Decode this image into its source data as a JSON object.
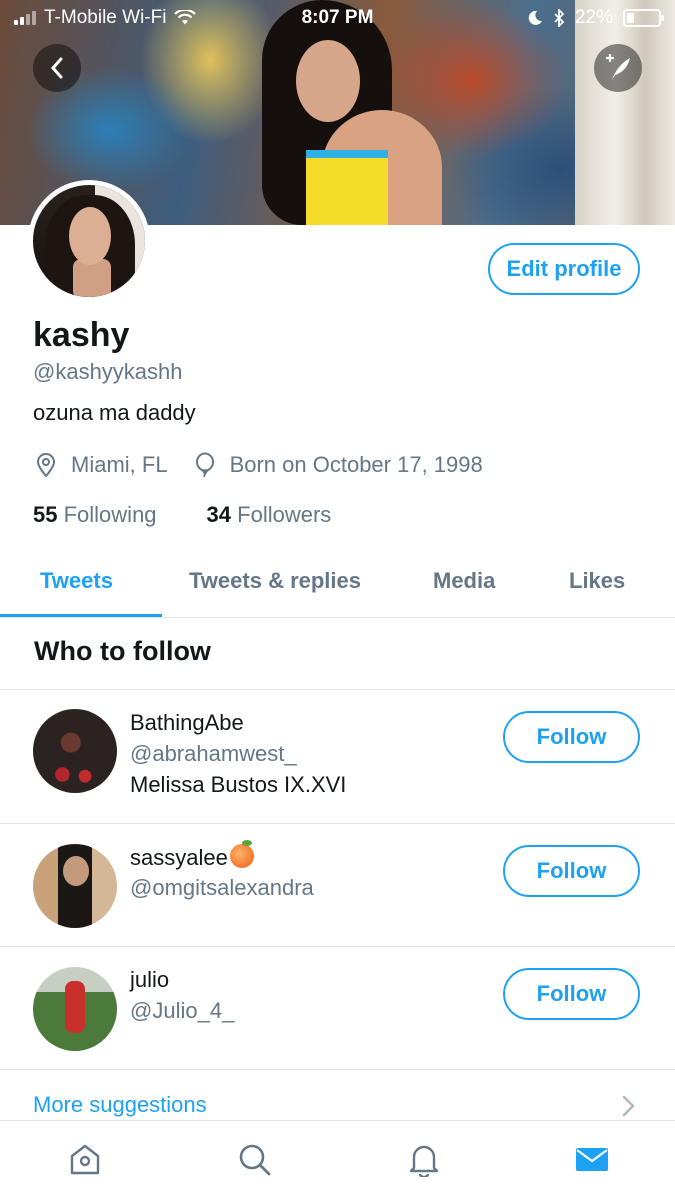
{
  "status_bar": {
    "carrier": "T-Mobile Wi-Fi",
    "time": "8:07 PM",
    "battery": "22%"
  },
  "profile": {
    "name": "kashy",
    "handle": "@kashyykashh",
    "bio": "ozuna ma daddy",
    "location": "Miami, FL",
    "birthday": "Born on October 17, 1998",
    "following_count": "55",
    "following_label": "Following",
    "followers_count": "34",
    "followers_label": "Followers",
    "edit_label": "Edit profile"
  },
  "tabs": [
    {
      "label": "Tweets",
      "active": true
    },
    {
      "label": "Tweets & replies",
      "active": false
    },
    {
      "label": "Media",
      "active": false
    },
    {
      "label": "Likes",
      "active": false
    }
  ],
  "who_to_follow": {
    "title": "Who to follow",
    "follow_label": "Follow",
    "users": [
      {
        "name": "BathingAbe",
        "handle": "@abrahamwest_",
        "bio": "Melissa Bustos IX.XVI"
      },
      {
        "name": "sassyalee",
        "handle": "@omgitsalexandra",
        "emoji": "peach"
      },
      {
        "name": "julio",
        "handle": "@Julio_4_"
      }
    ],
    "more_label": "More suggestions"
  },
  "bottom_nav": [
    "home-icon",
    "search-icon",
    "notifications-icon",
    "messages-icon"
  ],
  "colors": {
    "accent": "#1da1f2",
    "secondary_text": "#657786",
    "primary_text": "#14171a",
    "divider": "#e1e8ed"
  }
}
